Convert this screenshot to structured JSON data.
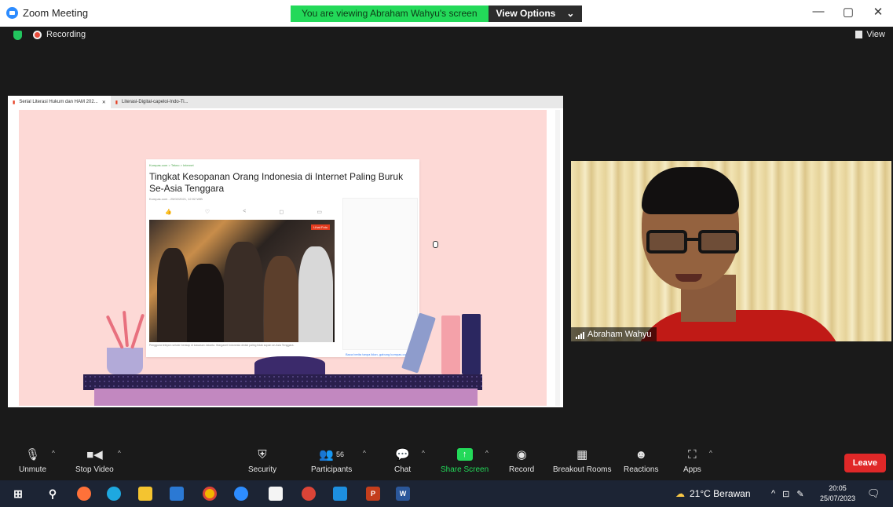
{
  "window": {
    "title": "Zoom Meeting",
    "banner_text": "You are viewing Abraham Wahyu's screen",
    "view_options_label": "View Options",
    "minimize": "—",
    "restore": "▢",
    "close": "✕"
  },
  "meeting_bar": {
    "recording_label": "Recording",
    "view_label": "View"
  },
  "shared_screen": {
    "tabs": [
      {
        "label": "Serial Literasi Hukum dan HAM 202..."
      },
      {
        "label": "Literasi-Digital-capeloi-Indo-Ti..."
      }
    ],
    "article": {
      "breadcrumb": "Kompas.com > Tekno > Internet",
      "title": "Tingkat Kesopanan Orang Indonesia di Internet Paling Buruk Se-Asia Tenggara",
      "date": "Kompas.com - 25/02/2021, 12:02 WIB",
      "photo_badge": "Lihat Foto",
      "caption": "Pengguna telepon seluler bersiap di kawasan Jakarta. Warganet Indonesia dinilai paling tidak sopan se-Asia Tenggara.",
      "ad_link": "Baca berita tanpa iklan, gabung kompas.com+"
    }
  },
  "participant": {
    "name": "Abraham Wahyu"
  },
  "controls": {
    "unmute": "Unmute",
    "stop_video": "Stop Video",
    "security": "Security",
    "participants": "Participants",
    "participants_count": "56",
    "chat": "Chat",
    "share_screen": "Share Screen",
    "record": "Record",
    "breakout_rooms": "Breakout Rooms",
    "reactions": "Reactions",
    "apps": "Apps",
    "leave": "Leave"
  },
  "taskbar": {
    "weather": "21°C  Berawan",
    "time": "20:05",
    "date": "25/07/2023"
  },
  "colors": {
    "banner_green": "#23d959",
    "leave_red": "#e02828",
    "share_green": "#23d959",
    "slide_pink": "#fdd9d6"
  }
}
